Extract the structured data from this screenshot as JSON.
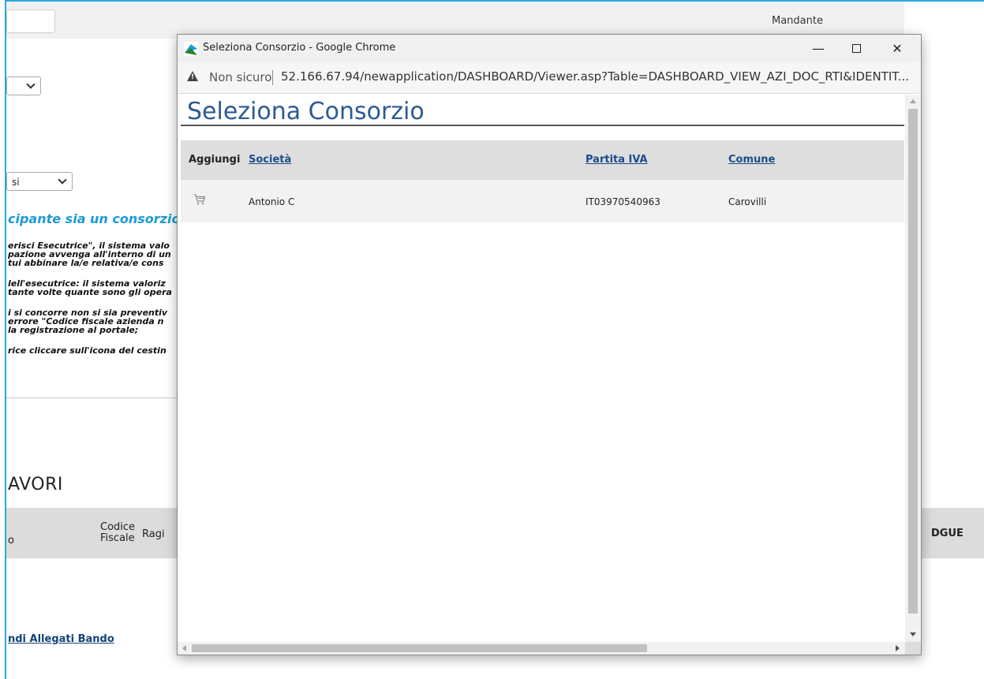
{
  "background": {
    "top_right_label": "Mandante",
    "select_2_value": "si",
    "heading_fragment": "cipante sia un consorzio,",
    "notes": [
      "erisci Esecutrice\", il sistema valo",
      "pazione avvenga all'interno di un",
      "tui abbinare la/e relativa/e cons",
      "",
      "lell'esecutrice: il sistema valoriz",
      "tante volte quante sono gli opera",
      "",
      "i si concorre non si sia preventiv",
      " errore \"Codice fiscale azienda n",
      "la registrazione al portale;",
      "",
      "rice cliccare sull'icona del cestin"
    ],
    "section_title": "AVORI",
    "table_headers": {
      "col_o": "o",
      "codice_fiscale": [
        "Codice",
        "Fiscale"
      ],
      "ragione": "Ragi",
      "dgue": "DGUE"
    },
    "link_text": "ndi Allegati Bando"
  },
  "popup": {
    "window_title": "Seleziona Consorzio - Google Chrome",
    "controls": {
      "minimize": "—",
      "close": "✕"
    },
    "address": {
      "security_label": "Non sicuro",
      "url": "52.166.67.94/newapplication/DASHBOARD/Viewer.asp?Table=DASHBOARD_VIEW_AZI_DOC_RTI&IDENTIT..."
    },
    "page_title": "Seleziona Consorzio",
    "grid": {
      "headers": {
        "aggiungi": "Aggiungi",
        "societa": "Società",
        "partita_iva": "Partita IVA",
        "comune": "Comune"
      },
      "rows": [
        {
          "societa": "Antonio C",
          "partita_iva": "IT03970540963",
          "comune": "Carovilli"
        }
      ]
    }
  },
  "colors": {
    "title_blue": "#2c5a92",
    "link_blue": "#1a4c8a",
    "accent_cyan": "#1d9ad6"
  }
}
